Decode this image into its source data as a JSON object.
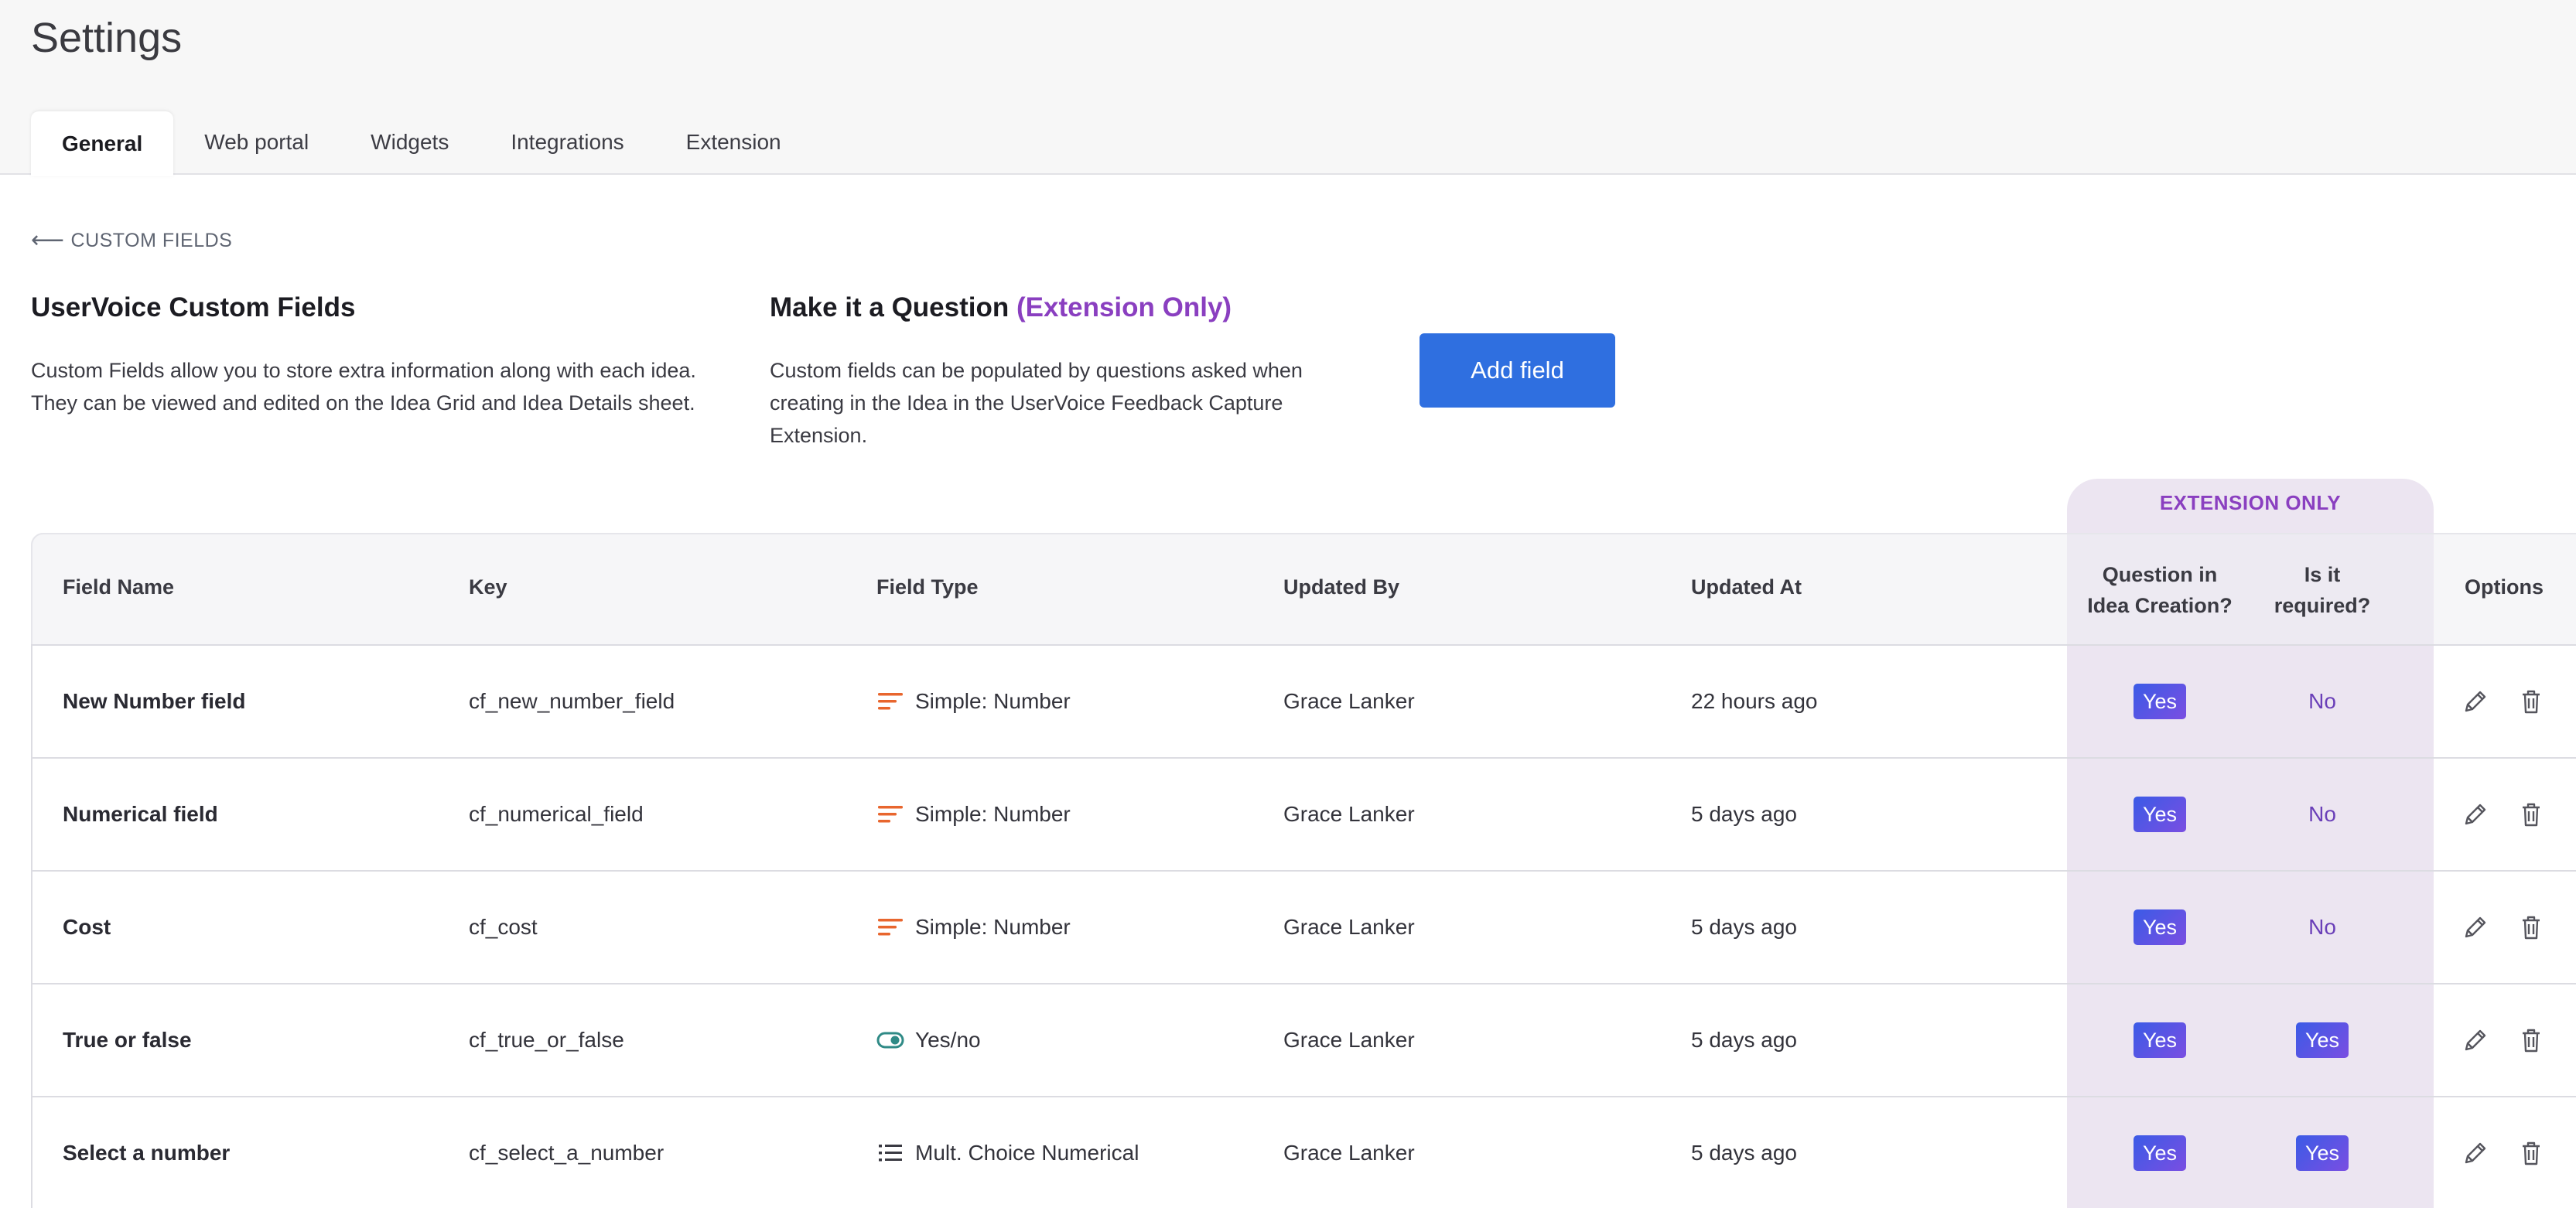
{
  "page": {
    "title": "Settings"
  },
  "tabs": [
    {
      "label": "General",
      "active": true
    },
    {
      "label": "Web portal",
      "active": false
    },
    {
      "label": "Widgets",
      "active": false
    },
    {
      "label": "Integrations",
      "active": false
    },
    {
      "label": "Extension",
      "active": false
    }
  ],
  "back_link": {
    "arrow": "⟵",
    "label": "CUSTOM FIELDS"
  },
  "intro": {
    "left_title": "UserVoice Custom Fields",
    "left_body": "Custom Fields allow you to store extra information along with each idea. They can be viewed and edited on the Idea Grid and Idea Details sheet.",
    "right_title": "Make it a Question",
    "right_title_accent": "(Extension Only)",
    "right_body": "Custom fields can be populated by questions asked when creating in the Idea in the UserVoice Feedback Capture Extension.",
    "add_button": "Add field"
  },
  "table": {
    "extension_label": "EXTENSION ONLY",
    "headers": {
      "field_name": "Field Name",
      "key": "Key",
      "field_type": "Field Type",
      "updated_by": "Updated By",
      "updated_at": "Updated At",
      "question_line1": "Question in",
      "question_line2": "Idea Creation?",
      "required_line1": "Is it",
      "required_line2": "required?",
      "options": "Options"
    },
    "rows": [
      {
        "name": "New Number field",
        "key": "cf_new_number_field",
        "type": "Simple: Number",
        "type_icon": "number-lines-icon",
        "updated_by": "Grace Lanker",
        "updated_at": "22 hours ago",
        "question": "Yes",
        "required": "No"
      },
      {
        "name": "Numerical field",
        "key": "cf_numerical_field",
        "type": "Simple: Number",
        "type_icon": "number-lines-icon",
        "updated_by": "Grace Lanker",
        "updated_at": "5 days ago",
        "question": "Yes",
        "required": "No"
      },
      {
        "name": "Cost",
        "key": "cf_cost",
        "type": "Simple: Number",
        "type_icon": "number-lines-icon",
        "updated_by": "Grace Lanker",
        "updated_at": "5 days ago",
        "question": "Yes",
        "required": "No"
      },
      {
        "name": "True or false",
        "key": "cf_true_or_false",
        "type": "Yes/no",
        "type_icon": "toggle-icon",
        "updated_by": "Grace Lanker",
        "updated_at": "5 days ago",
        "question": "Yes",
        "required": "Yes"
      },
      {
        "name": "Select a number",
        "key": "cf_select_a_number",
        "type": "Mult. Choice Numerical",
        "type_icon": "list-icon",
        "updated_by": "Grace Lanker",
        "updated_at": "5 days ago",
        "question": "Yes",
        "required": "Yes"
      }
    ]
  },
  "colors": {
    "accent_purple": "#8a3fc0",
    "button_blue": "#2f6fe0",
    "number_icon_orange": "#e8662e",
    "toggle_teal": "#2f8a86",
    "extension_band": "#ece5f1"
  }
}
